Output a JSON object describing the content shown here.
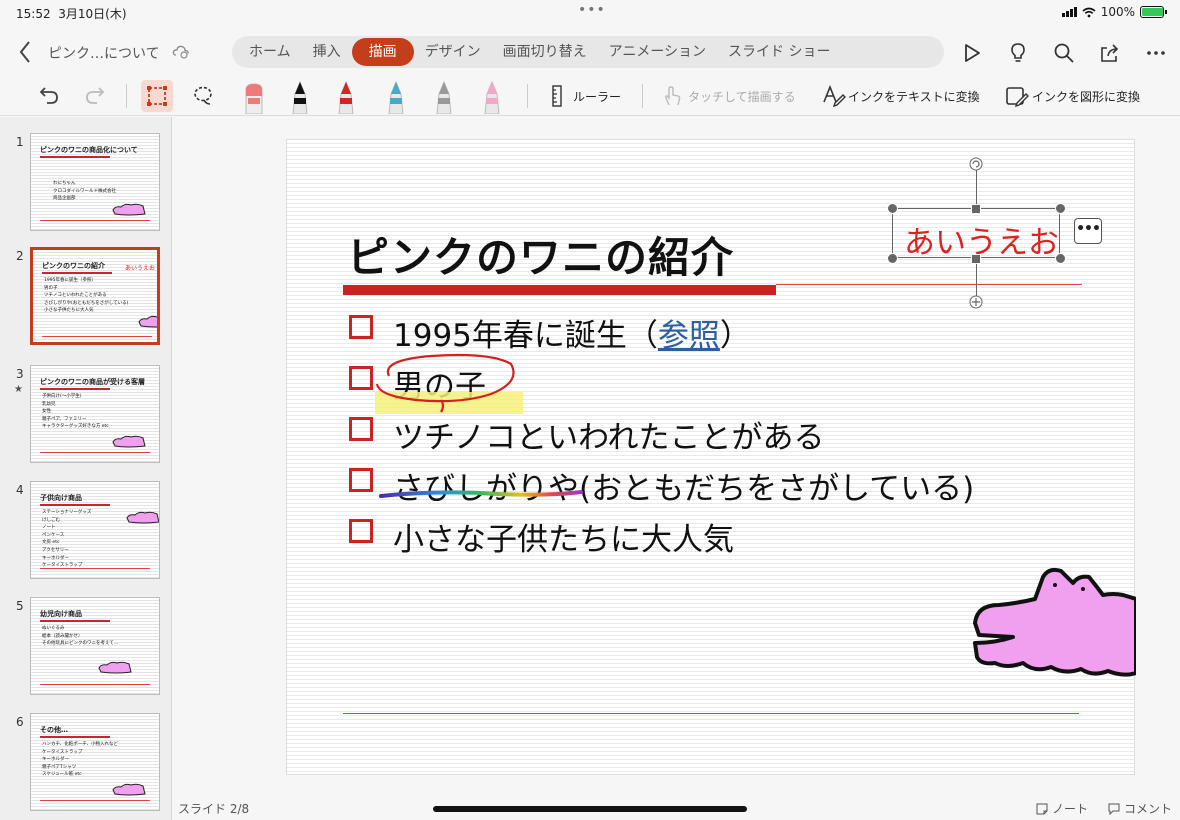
{
  "status": {
    "time": "15:52",
    "date": "3月10日(木)",
    "battery": "100%",
    "battery_level": 1.0
  },
  "header": {
    "back_label": "<",
    "doc_title": "ピンク…について"
  },
  "ribbon_tabs": [
    {
      "label": "ホーム"
    },
    {
      "label": "挿入"
    },
    {
      "label": "描画"
    },
    {
      "label": "デザイン"
    },
    {
      "label": "画面切り替え"
    },
    {
      "label": "アニメーション"
    },
    {
      "label": "スライド ショー"
    }
  ],
  "active_tab": "描画",
  "draw_toolbar": {
    "ruler": "ルーラー",
    "touch_draw": "タッチして描画する",
    "ink_to_text": "インクをテキストに変換",
    "ink_to_shape": "インクを図形に変換",
    "pen_colors": [
      "#f07a7a",
      "#111111",
      "#d22626",
      "#4aa8c8",
      "#999999",
      "#f4a6c8"
    ]
  },
  "thumbnails": [
    {
      "num": "1",
      "title": "ピンクのワニの商品化について",
      "lines": [
        "わにちゃん",
        "クロコダイルワールド株式会社",
        "商品企画部"
      ]
    },
    {
      "num": "2",
      "title": "ピンクのワニの紹介",
      "ink": "あいうえお",
      "lines": [
        "1995年春に誕生（参照）",
        "男の子",
        "ツチノコといわれたことがある",
        "さびしがりや(おともだちをさがしている)",
        "小さな子供たちに大人気"
      ]
    },
    {
      "num": "3",
      "title": "ピンクのワニの商品が受ける客層",
      "lines": [
        "子供向け(〜小学生)",
        "乳幼児",
        "女性",
        "親子ペア、ファミリー",
        "キャラクターグッズ好きな方 etc"
      ]
    },
    {
      "num": "4",
      "title": "子供向け商品",
      "lines": [
        "ステーショナリーグッズ",
        "けしごむ",
        "ノート",
        "ペンケース",
        "文房 etc",
        "アクセサリー",
        "キーホルダー",
        "ケータイストラップ"
      ]
    },
    {
      "num": "5",
      "title": "幼児向け商品",
      "lines": [
        "ぬいぐるみ",
        "絵本（読み聞かせ）",
        "その他玩具にピンクのワニを考えて…"
      ]
    },
    {
      "num": "6",
      "title": "その他…",
      "lines": [
        "ハンカチ、化粧ポーチ、小物入れなど",
        "ケータイストラップ",
        "キーホルダー",
        "親子ペアTシャツ",
        "スケジュール帳 etc"
      ]
    }
  ],
  "slide": {
    "title": "ピンクのワニの紹介",
    "ink_text": "あいうえお",
    "bullets": [
      {
        "pre": "1995年春に誕生（",
        "link": "参照",
        "post": "）"
      },
      {
        "pre": "男の子",
        "link": "",
        "post": ""
      },
      {
        "pre": "ツチノコといわれたことがある",
        "link": "",
        "post": ""
      },
      {
        "pre": "さびしがりや(おともだちをさがしている)",
        "link": "",
        "post": ""
      },
      {
        "pre": "小さな子供たちに大人気",
        "link": "",
        "post": ""
      }
    ],
    "more_label": "•••"
  },
  "footer": {
    "slide_counter": "スライド 2/8",
    "notes": "ノート",
    "comments": "コメント"
  },
  "colors": {
    "accent": "#c43e1c",
    "bullet_red": "#cc2222",
    "croc_pink": "#f0a0ee",
    "highlight": "#f5f07a"
  }
}
